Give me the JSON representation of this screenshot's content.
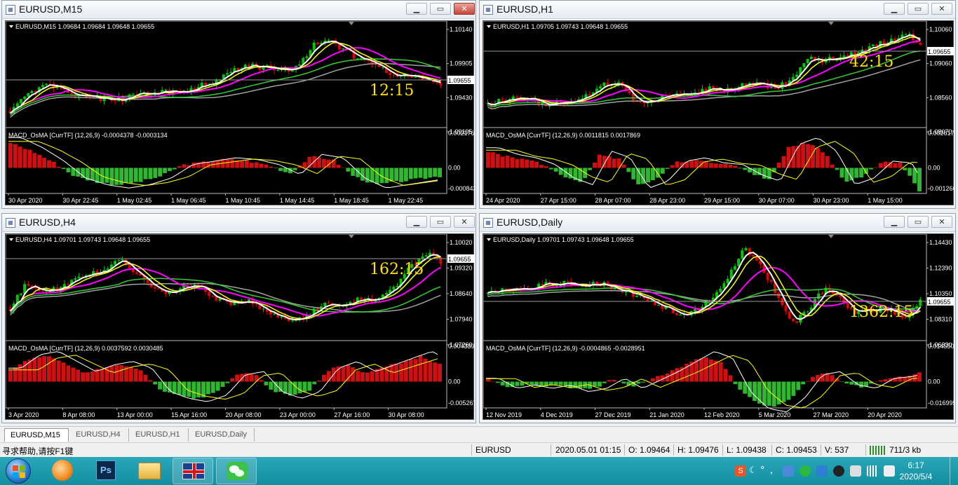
{
  "windows": [
    {
      "key": "m15",
      "title": "EURUSD,M15",
      "info": "EURUSD,M15  1.09684 1.09684 1.09648 1.09655",
      "countdown": "12:15",
      "price_labels": [
        "1.10140",
        "1.09905",
        "1.09655",
        "1.09430",
        "1.09195"
      ],
      "current_price": "1.09655",
      "indicator": "MACD_OsMA [CurrTF] (12,26,9) -0.0004378 -0.0003134",
      "ind_labels": [
        "0.0021761",
        "0.00",
        "-0.000842"
      ],
      "time_labels": [
        "30 Apr 2020",
        "30 Apr 22:45",
        "1 May 02:45",
        "1 May 06:45",
        "1 May 10:45",
        "1 May 14:45",
        "1 May 18:45",
        "1 May 22:45"
      ],
      "close_style": "red"
    },
    {
      "key": "h1",
      "title": "EURUSD,H1",
      "info": "EURUSD,H1  1.09705 1.09743 1.09648 1.09655",
      "countdown": "42:15",
      "price_labels": [
        "1.10060",
        "1.09655",
        "1.09060",
        "1.08560",
        "1.08070"
      ],
      "current_price": "1.09655",
      "indicator": "MACD_OsMA [CurrTF] (12,26,9) 0.0011815 0.0017869",
      "ind_labels": [
        "0.0026174",
        "0.00",
        "-0.001266"
      ],
      "time_labels": [
        "24 Apr 2020",
        "27 Apr 15:00",
        "28 Apr 07:00",
        "28 Apr 23:00",
        "29 Apr 15:00",
        "30 Apr 07:00",
        "30 Apr 23:00",
        "1 May 15:00"
      ],
      "close_style": "plain"
    },
    {
      "key": "h4",
      "title": "EURUSD,H4",
      "info": "EURUSD,H4  1.09701 1.09743 1.09648 1.09655",
      "countdown": "162:15",
      "price_labels": [
        "1.10020",
        "1.09655",
        "1.09320",
        "1.08640",
        "1.07940",
        "1.07260"
      ],
      "current_price": "1.09655",
      "indicator": "MACD_OsMA [CurrTF] (12,26,9) 0.0037592 0.0030485",
      "ind_labels": [
        "0.0043393",
        "0.00",
        "-0.005267"
      ],
      "time_labels": [
        "3 Apr 2020",
        "8 Apr 08:00",
        "13 Apr 00:00",
        "15 Apr 16:00",
        "20 Apr 08:00",
        "23 Apr 00:00",
        "27 Apr 16:00",
        "30 Apr 08:00"
      ],
      "close_style": "plain"
    },
    {
      "key": "d1",
      "title": "EURUSD,Daily",
      "info": "EURUSD,Daily  1.09701 1.09743 1.09648 1.09655",
      "countdown": "1362:15",
      "price_labels": [
        "1.14430",
        "1.12390",
        "1.10350",
        "1.09655",
        "1.08310",
        "1.06330"
      ],
      "current_price": "1.09655",
      "indicator": "MACD_OsMA [CurrTF] (12,26,9) -0.0004865 -0.0028951",
      "ind_labels": [
        "0.0145509",
        "0.00",
        "-0.016995"
      ],
      "time_labels": [
        "12 Nov 2019",
        "4 Dec 2019",
        "27 Dec 2019",
        "21 Jan 2020",
        "12 Feb 2020",
        "5 Mar 2020",
        "27 Mar 2020",
        "20 Apr 2020"
      ],
      "close_style": "plain"
    }
  ],
  "tabs": [
    "EURUSD,M15",
    "EURUSD,H4",
    "EURUSD,H1",
    "EURUSD,Daily"
  ],
  "status": {
    "help": "寻求帮助,请按F1键",
    "symbol": "EURUSD",
    "datetime": "2020.05.01 01:15",
    "open": "O: 1.09464",
    "high": "H: 1.09476",
    "low": "L: 1.09438",
    "close": "C: 1.09453",
    "volume": "V: 537",
    "traffic": "711/3 kb"
  },
  "taskbar": {
    "apps": [
      "start-orb",
      "foxmail-app",
      "photoshop-app",
      "file-explorer-app",
      "uk-flag-app",
      "wechat-app"
    ],
    "ps_label": "Ps",
    "time": "6:17",
    "date": "2020/5/4"
  },
  "colors": {
    "chart_bg": "#000000",
    "bull": "#00c800",
    "bear": "#e00000",
    "fast_ma": "#ffffff",
    "mid_ma": "#ffff00",
    "slow_ma": "#ff00ff",
    "ma_green": "#32cd32",
    "ma_gray": "#a0a0a0",
    "countdown": "#ffe000",
    "taskbar": "#1a9caf"
  },
  "icons": {
    "window_icon": "chart-window-icon",
    "minimize": "minimize-icon",
    "maximize": "maximize-icon",
    "close": "close-icon"
  }
}
